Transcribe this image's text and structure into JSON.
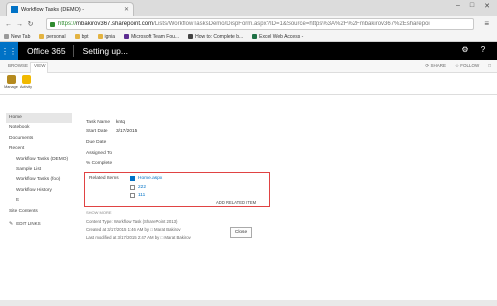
{
  "browser": {
    "tab_title": "Workflow Tasks (DEMO) -",
    "url_https": "https://",
    "url_host": "mbakirov367.sharepoint.com",
    "url_rest": "/Lists/WorkflowTasksDemo/DispForm.aspx?ID=1&Source=https%3A%2F%2Fmbakirov367%2Esharepoi",
    "bookmarks": [
      {
        "label": "New Tab",
        "color": "#9a9a9a"
      },
      {
        "label": "personal",
        "color": "#e3b341"
      },
      {
        "label": "bpt",
        "color": "#e3b341"
      },
      {
        "label": "ignia",
        "color": "#e3b341"
      },
      {
        "label": "Microsoft Team Fou...",
        "color": "#5c2d91"
      },
      {
        "label": "How to: Complete b...",
        "color": "#444444"
      },
      {
        "label": "Excel Web Access -",
        "color": "#1e7145"
      }
    ]
  },
  "suite": {
    "brand": "Office 365",
    "title": "Setting up..."
  },
  "ribbon": {
    "tabs": [
      "BROWSE",
      "VIEW"
    ],
    "share": "SHARE",
    "follow": "FOLLOW",
    "buttons": [
      {
        "label": "Manage",
        "color": "#b58a1e"
      },
      {
        "label": "Activity",
        "color": "#f1b900"
      }
    ]
  },
  "nav": {
    "items": [
      {
        "label": "Home",
        "sub": false,
        "selected": true
      },
      {
        "label": "Notebook",
        "sub": false
      },
      {
        "label": "Documents",
        "sub": false
      },
      {
        "label": "Recent",
        "sub": false
      },
      {
        "label": "Workflow Tasks (DEMO)",
        "sub": true
      },
      {
        "label": "Sample List",
        "sub": true
      },
      {
        "label": "Workflow Tasks (foo)",
        "sub": true
      },
      {
        "label": "Workflow History",
        "sub": true
      },
      {
        "label": "tt",
        "sub": true
      },
      {
        "label": "Site Contents",
        "sub": false
      }
    ],
    "edit_links": "EDIT LINKS"
  },
  "form": {
    "fields": [
      {
        "label": "Task Name",
        "value": "kntq"
      },
      {
        "label": "Start Date",
        "value": "3/17/2015"
      },
      {
        "label": "Due Date",
        "value": ""
      },
      {
        "label": "Assigned To",
        "value": ""
      },
      {
        "label": "% Complete",
        "value": ""
      }
    ],
    "related_label": "Related Items",
    "related_items": [
      {
        "label": "Home.aspx",
        "icon": "page-icon"
      },
      {
        "label": "222",
        "icon": "document-icon"
      },
      {
        "label": "111",
        "icon": "document-icon"
      }
    ],
    "add_related": "ADD RELATED ITEM",
    "show_more": "SHOW MORE",
    "meta": {
      "content_type": "Content Type: Workflow Task (SharePoint 2013)",
      "created": "Created at 3/17/2015 1:46 AM  by  □ Marat Bakirov",
      "modified": "Last modified at 3/17/2015 2:47 AM  by  □ Marat Bakirov"
    },
    "close_label": "Close"
  }
}
